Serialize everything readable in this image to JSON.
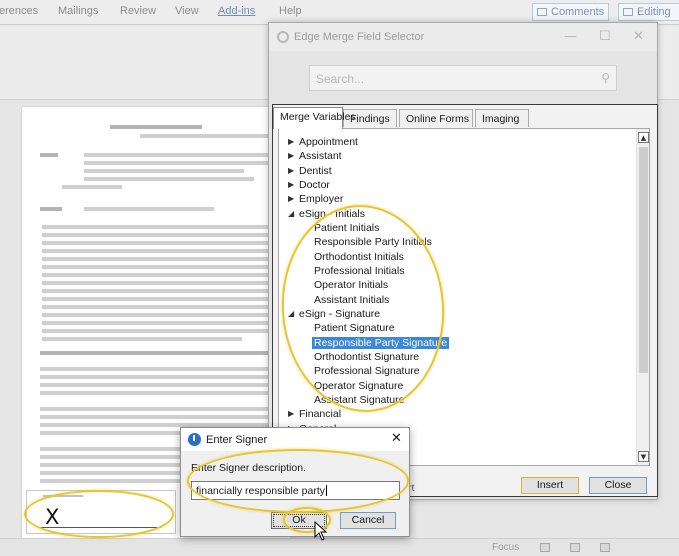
{
  "word": {
    "ribbon_tabs": [
      "erences",
      "Mailings",
      "Review",
      "View",
      "Add-ins",
      "Help"
    ],
    "active_tab": "Add-ins",
    "comments_label": "Comments",
    "editing_label": "Editing",
    "status_focus": "Focus"
  },
  "selector": {
    "title": "Edge Merge Field Selector",
    "search_placeholder": "Search...",
    "tabs": [
      "Merge Variables",
      "Findings",
      "Online Forms",
      "Imaging"
    ],
    "tree": {
      "appointment": "Appointment",
      "assistant": "Assistant",
      "dentist": "Dentist",
      "doctor": "Doctor",
      "employer": "Employer",
      "esign_initials": "eSign - Initials",
      "patient_initials": "Patient Initials",
      "rp_initials": "Responsible Party Initials",
      "ortho_initials": "Orthodontist Initials",
      "prof_initials": "Professional Initials",
      "op_initials": "Operator Initials",
      "asst_initials": "Assistant Initials",
      "esign_signature": "eSign - Signature",
      "patient_signature": "Patient Signature",
      "rp_signature": "Responsible Party Signature",
      "ortho_signature": "Orthodontist Signature",
      "prof_signature": "Professional Signature",
      "op_signature": "Operator Signature",
      "asst_signature": "Assistant Signature",
      "financial": "Financial",
      "general": "General"
    },
    "footer_partial": "rt",
    "insert_label": "Insert",
    "close_label": "Close"
  },
  "signer": {
    "title": "Enter Signer",
    "close_glyph": "✕",
    "prompt": "Enter Signer description.",
    "value": "financially responsible party",
    "ok_label": "Ok",
    "cancel_label": "Cancel"
  },
  "signature_block": {
    "mark": "X"
  },
  "colors": {
    "highlight": "#e8c52e",
    "selection": "#3b87d8",
    "insert_border": "#e2b13c"
  }
}
